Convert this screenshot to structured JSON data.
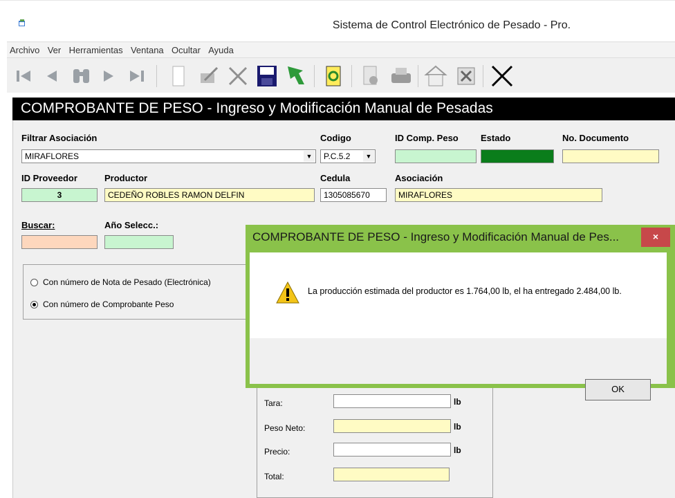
{
  "window": {
    "title": "Sistema de Control Electrónico de Pesado - Pro."
  },
  "menu": [
    "Archivo",
    "Ver",
    "Herramientas",
    "Ventana",
    "Ocultar",
    "Ayuda"
  ],
  "header": {
    "title": "COMPROBANTE DE PESO - Ingreso y Modificación Manual de Pesadas"
  },
  "form": {
    "filtrar_label": "Filtrar Asociación",
    "filtrar_value": "MIRAFLORES",
    "codigo_label": "Codigo",
    "codigo_value": "P.C.5.2",
    "idcomp_label": "ID Comp. Peso",
    "idcomp_value": "",
    "estado_label": "Estado",
    "nodoc_label": "No. Documento",
    "nodoc_value": "",
    "idprov_label": "ID Proveedor",
    "idprov_value": "3",
    "productor_label": "Productor",
    "productor_value": "CEDEÑO ROBLES RAMON DELFIN",
    "cedula_label": "Cedula",
    "cedula_value": "1305085670",
    "asociacion_label": "Asociación",
    "asociacion_value": "MIRAFLORES",
    "buscar_label": "Buscar:",
    "anio_label": "Año Selecc.:",
    "radio_nota": "Con número de Nota de Pesado (Electrónica)",
    "radio_comp": "Con número de Comprobante Peso",
    "tara_label": "Tara:",
    "peso_neto_label": "Peso Neto:",
    "precio_label": "Precio:",
    "total_label": "Total:",
    "unit_lb": "lb"
  },
  "dialog": {
    "title": "COMPROBANTE DE PESO - Ingreso y Modificación Manual de Pes...",
    "close": "×",
    "message": "La producción estimada del productor es 1.764,00 lb, el ha entregado 2.484,00 lb.",
    "ok": "OK"
  },
  "colors": {
    "header_bg": "#000000",
    "dialog_border": "#8ac24a",
    "estado": "#0a7d1b"
  }
}
